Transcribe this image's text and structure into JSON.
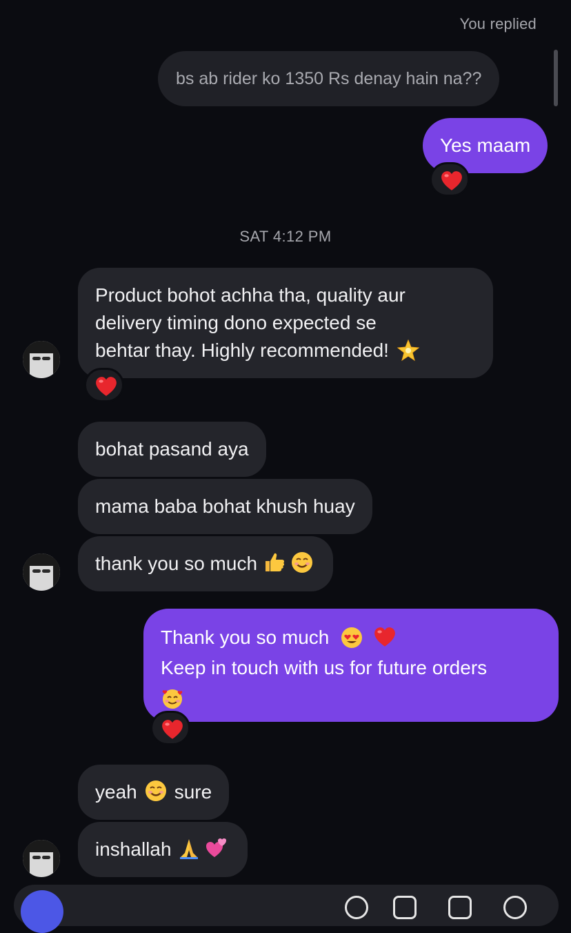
{
  "thread": {
    "reply_label": "You replied",
    "quoted_message": "bs ab rider ko 1350 Rs denay hain na??",
    "timestamp": "SAT 4:12 PM"
  },
  "messages": {
    "m1": {
      "text": "Yes maam"
    },
    "m2": {
      "lines": [
        "Product bohot achha tha, quality aur",
        "delivery timing dono expected se",
        "behtar thay. Highly recommended!"
      ]
    },
    "m3": {
      "text": "bohat pasand aya"
    },
    "m4": {
      "text": "mama baba bohat khush huay"
    },
    "m5": {
      "text": "thank you so much"
    },
    "m6": {
      "lines": [
        "Thank you so much",
        "Keep in touch with us for future orders"
      ]
    },
    "m7": {
      "parts": [
        "yeah",
        "sure"
      ]
    },
    "m8": {
      "text": "inshallah"
    }
  },
  "icons": {
    "reaction": "red-heart",
    "sparkle": "glowing-star",
    "thumbs_up": "thumbs-up",
    "smile": "smiling-face",
    "heart_eyes": "heart-eyes-face",
    "heart": "red-heart",
    "hearts_face": "smiling-face-with-hearts",
    "folded_hands": "folded-hands",
    "revolving_hearts": "revolving-hearts"
  },
  "colors": {
    "background": "#0b0c11",
    "incoming_bubble": "#24252b",
    "outgoing_bubble": "#7a43e6",
    "quoted_bubble": "#202127",
    "secondary_text": "#a6a7ad"
  }
}
